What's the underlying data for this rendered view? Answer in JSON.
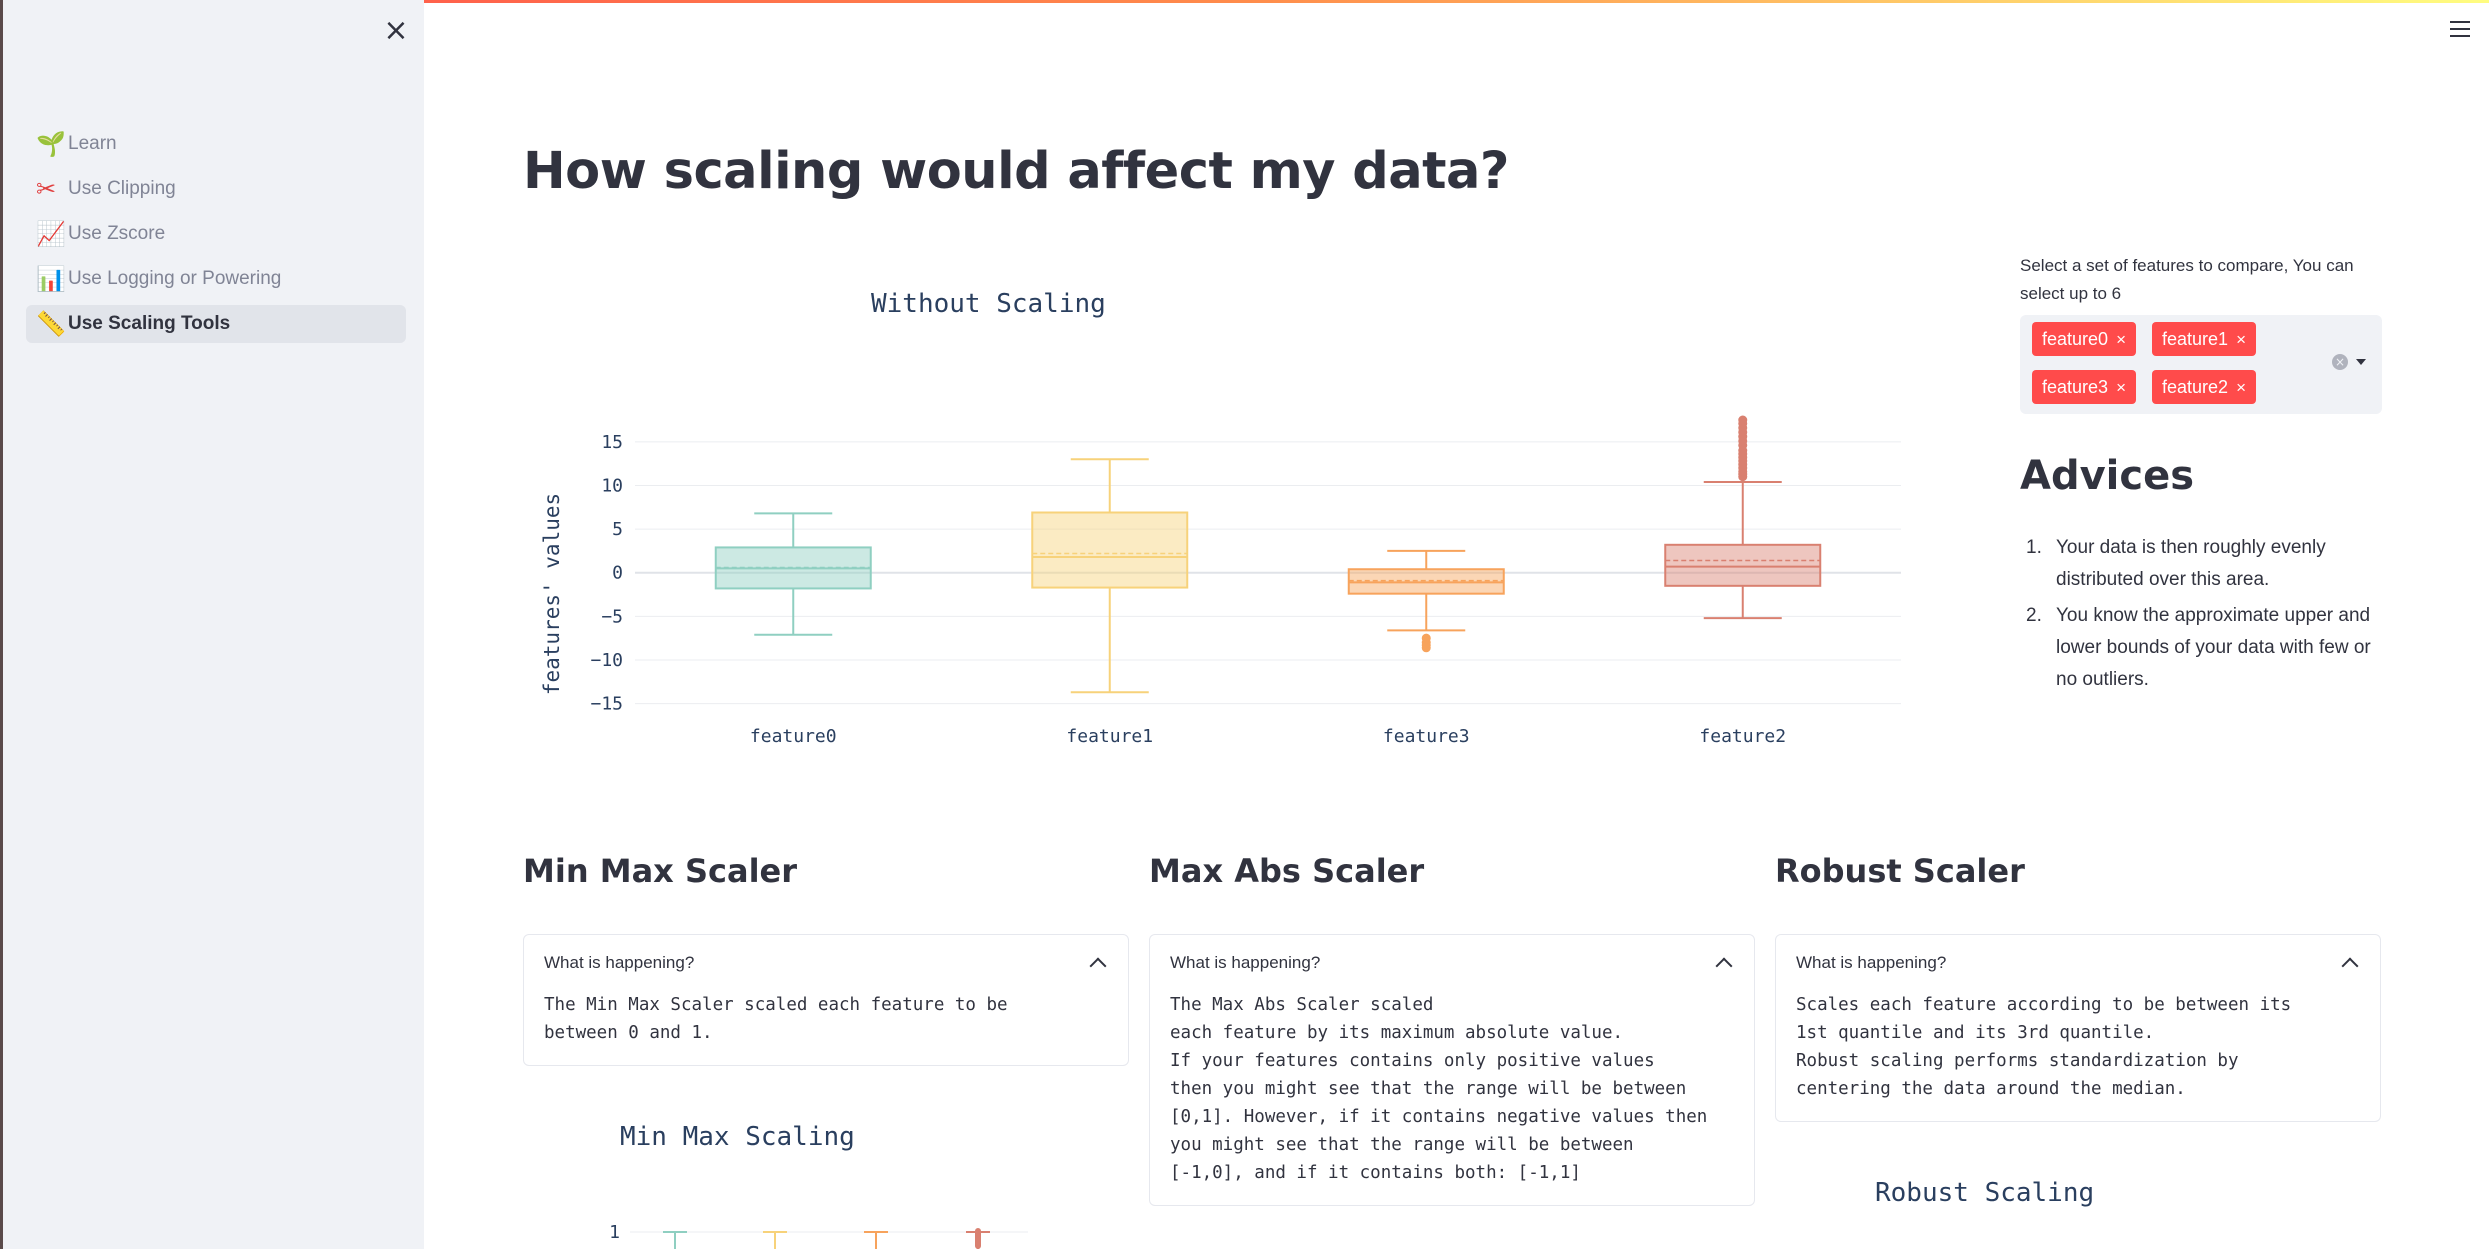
{
  "sidebar": {
    "close_icon": "close-icon",
    "items": [
      {
        "icon": "🌱",
        "icon_name": "seedling-icon",
        "label": "Learn",
        "active": false
      },
      {
        "icon": "✂",
        "icon_name": "scissors-icon",
        "label": "Use Clipping",
        "active": false
      },
      {
        "icon": "📈",
        "icon_name": "chart-increasing-icon",
        "label": "Use Zscore",
        "active": false
      },
      {
        "icon": "📊",
        "icon_name": "bar-chart-icon",
        "label": "Use Logging or Powering",
        "active": false
      },
      {
        "icon": "📏",
        "icon_name": "ruler-icon",
        "label": "Use Scaling Tools",
        "active": true
      }
    ]
  },
  "header": {
    "menu_icon": "hamburger-menu-icon"
  },
  "main": {
    "title": "How scaling would affect my data?"
  },
  "selector": {
    "label": "Select a set of features to compare, You can select up to 6",
    "tags": [
      "feature0",
      "feature1",
      "feature3",
      "feature2"
    ],
    "remove_glyph": "×"
  },
  "advices": {
    "title": "Advices",
    "items": [
      "Your data is then roughly evenly distributed over this area.",
      "You know the approximate upper and lower bounds of your data with few or no outliers."
    ]
  },
  "columns": [
    {
      "title": "Min Max Scaler",
      "expander_label": "What is happening?",
      "body": "The Min Max Scaler scaled each feature to be\nbetween 0 and 1."
    },
    {
      "title": "Max Abs Scaler",
      "expander_label": "What is happening?",
      "body": "The Max Abs Scaler scaled\neach feature by its maximum absolute value.\nIf your features contains only positive values\nthen you might see that the range will be between\n[0,1]. However, if it contains negative values then\nyou might see that the range will be between\n[-1,0], and if it contains both: [-1,1]"
    },
    {
      "title": "Robust Scaler",
      "expander_label": "What is happening?",
      "body": "Scales each feature according to be between its\n1st quantile and its 3rd quantile.\nRobust scaling performs standardization by\ncentering the data around the median."
    }
  ],
  "colors": {
    "accent": "#ff4b4b",
    "feature0": "#8fcfc1",
    "feature1": "#f7d27a",
    "feature3": "#f7a35c",
    "feature2": "#d98070"
  },
  "chart_data": [
    {
      "type": "box",
      "title": "Without Scaling",
      "xlabel": "",
      "ylabel": "features' values",
      "ylim": [
        -15.5,
        17.5
      ],
      "yticks": [
        -15,
        -10,
        -5,
        0,
        5,
        10,
        15
      ],
      "ytick_labels": [
        "−15",
        "−10",
        "−5",
        "0",
        "5",
        "10",
        "15"
      ],
      "grid": true,
      "categories": [
        "feature0",
        "feature1",
        "feature3",
        "feature2"
      ],
      "boxes": [
        {
          "name": "feature0",
          "min": -7.1,
          "q1": -1.8,
          "median": 0.5,
          "mean": 0.6,
          "q3": 2.9,
          "max": 6.8,
          "outliers": []
        },
        {
          "name": "feature1",
          "min": -13.7,
          "q1": -1.7,
          "median": 1.8,
          "mean": 2.2,
          "q3": 6.9,
          "max": 13.0,
          "outliers": []
        },
        {
          "name": "feature3",
          "min": -6.6,
          "q1": -2.4,
          "median": -1.1,
          "mean": -0.9,
          "q3": 0.4,
          "max": 2.5,
          "outliers": [
            -7.5,
            -8.0,
            -8.3,
            -8.6
          ]
        },
        {
          "name": "feature2",
          "min": -5.2,
          "q1": -1.5,
          "median": 0.7,
          "mean": 1.4,
          "q3": 3.2,
          "max": 10.4,
          "outliers": [
            11.0,
            11.3,
            11.6,
            12.0,
            12.4,
            12.8,
            13.2,
            13.6,
            14.0,
            14.6,
            15.1,
            15.6,
            16.1,
            16.6,
            17.1,
            17.5
          ]
        }
      ]
    },
    {
      "type": "box",
      "title": "Min Max Scaling",
      "yticks": [
        1
      ],
      "ytick_labels": [
        "1"
      ]
    },
    {
      "type": "box",
      "title": "Robust Scaling"
    }
  ]
}
